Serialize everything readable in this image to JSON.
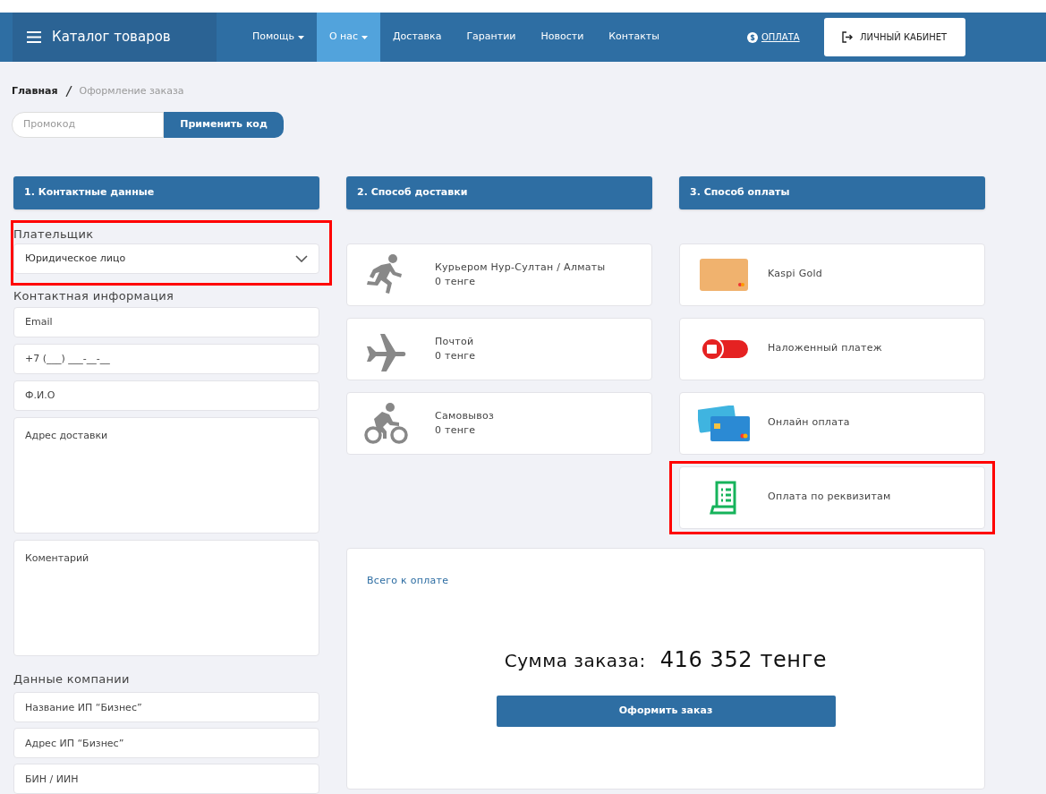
{
  "header": {
    "catalog": "Каталог товаров",
    "nav": [
      {
        "label": "Помощь",
        "dropdown": true,
        "selected": false
      },
      {
        "label": "О нас",
        "dropdown": true,
        "selected": true
      },
      {
        "label": "Доставка",
        "dropdown": false,
        "selected": false
      },
      {
        "label": "Гарантии",
        "dropdown": false,
        "selected": false
      },
      {
        "label": "Новости",
        "dropdown": false,
        "selected": false
      },
      {
        "label": "Контакты",
        "dropdown": false,
        "selected": false
      }
    ],
    "payment_link": "ОПЛАТА",
    "account_button": "ЛИЧНЫЙ КАБИНЕТ"
  },
  "breadcrumb": [
    "Главная",
    "Оформление заказа"
  ],
  "promo": {
    "placeholder": "Промокод",
    "button": "Применить код"
  },
  "contact": {
    "title": "1. Контактные данные",
    "payer_label": "Плательщик",
    "payer_value": "Юридическое лицо",
    "payer_highlighted": true,
    "contact_label": "Контактная информация",
    "fields": [
      {
        "kind": "input",
        "placeholder": "Email"
      },
      {
        "kind": "input",
        "placeholder": "+7 (___) ___-__-__"
      },
      {
        "kind": "input",
        "placeholder": "Ф.И.О"
      },
      {
        "kind": "textarea",
        "placeholder": "Адрес доставки"
      },
      {
        "kind": "textarea",
        "placeholder": "Коментарий"
      }
    ],
    "company_label": "Данные компании",
    "company_fields": [
      {
        "placeholder": "Название ИП “Бизнес”"
      },
      {
        "placeholder": "Адрес ИП “Бизнес”"
      },
      {
        "placeholder": "БИН / ИИН"
      }
    ]
  },
  "delivery": {
    "title": "2. Способ доставки",
    "options": [
      {
        "name": "Курьером Нур-Султан / Алматы",
        "price": "0 тенге"
      },
      {
        "name": "Почтой",
        "price": "0 тенге"
      },
      {
        "name": "Самовывоз",
        "price": "0 тенге"
      }
    ]
  },
  "payment": {
    "title": "3. Способ оплаты",
    "options": [
      {
        "name": "Kaspi Gold",
        "highlighted": false
      },
      {
        "name": "Наложенный платеж",
        "highlighted": false
      },
      {
        "name": "Онлайн оплата",
        "highlighted": false
      },
      {
        "name": "Оплата по реквизитам",
        "highlighted": true
      }
    ]
  },
  "summary": {
    "total_link": "Всего к оплате",
    "sum_label": "Сумма заказа:",
    "sum_value": "416 352 тенге",
    "button": "Оформить заказ"
  }
}
